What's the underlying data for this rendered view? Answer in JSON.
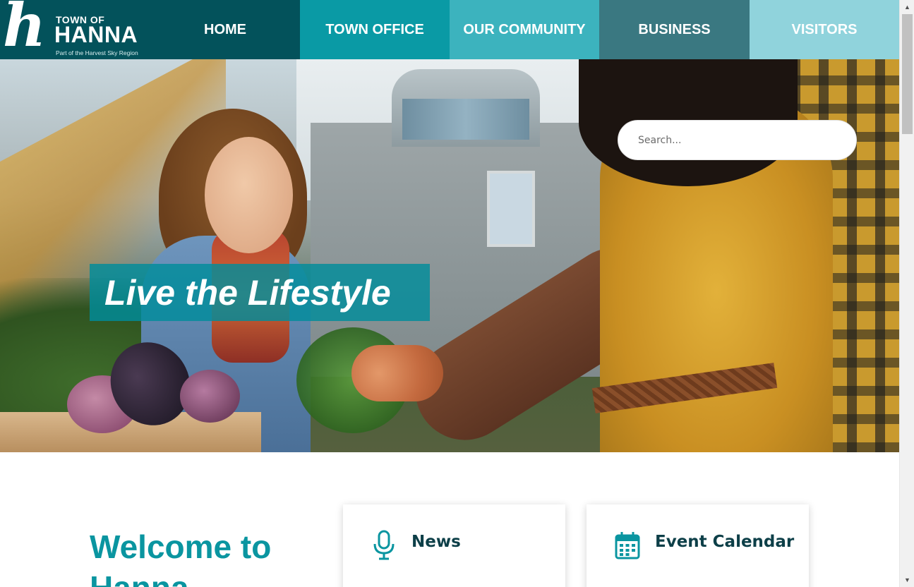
{
  "site": {
    "logo": {
      "mark": "h",
      "town_of": "TOWN OF",
      "name": "HANNA",
      "tagline": "Part of the Harvest Sky Region"
    }
  },
  "nav": {
    "items": [
      {
        "label": "HOME",
        "color": "#03525b"
      },
      {
        "label": "TOWN OFFICE",
        "color": "#0a9aa5"
      },
      {
        "label": "OUR COMMUNITY",
        "color": "#3cb3be"
      },
      {
        "label": "BUSINESS",
        "color": "#3a7881"
      },
      {
        "label": "VISITORS",
        "color": "#90d3dc"
      }
    ]
  },
  "hero": {
    "search_placeholder": "Search...",
    "banner_text": "Live the Lifestyle",
    "banner_color": "#008c9b"
  },
  "main": {
    "welcome_heading": "Welcome to Hanna",
    "heading_color": "#0a95a0",
    "cards": [
      {
        "label": "News",
        "icon": "microphone-icon"
      },
      {
        "label": "Event Calendar",
        "icon": "calendar-icon"
      }
    ]
  },
  "scrollbar": {
    "up_glyph": "▲",
    "down_glyph": "▼"
  }
}
